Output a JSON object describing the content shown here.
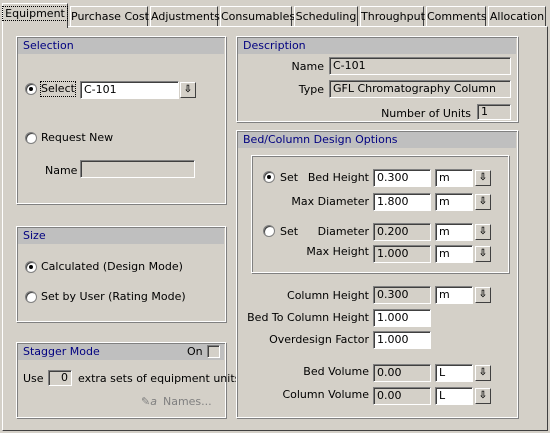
{
  "tabs": [
    "Equipment",
    "Purchase Cost",
    "Adjustments",
    "Consumables",
    "Scheduling",
    "Throughput",
    "Comments",
    "Allocation"
  ],
  "active_tab": "Equipment",
  "selection": {
    "header": "Selection",
    "select_label": "Select",
    "select_value": "C-101",
    "request_new_label": "Request New",
    "name_label": "Name",
    "name_value": ""
  },
  "size": {
    "header": "Size",
    "calculated_label": "Calculated (Design Mode)",
    "rating_label": "Set by User (Rating Mode)"
  },
  "stagger": {
    "header": "Stagger Mode",
    "on_label": "On",
    "use_label": "Use",
    "use_value": "0",
    "extra_label": "extra sets of equipment units",
    "names_button": "Names..."
  },
  "description": {
    "header": "Description",
    "name_label": "Name",
    "name_value": "C-101",
    "type_label": "Type",
    "type_value": "GFL Chromatography Column",
    "units_label": "Number of Units",
    "units_value": "1"
  },
  "bed": {
    "header": "Bed/Column Design Options",
    "set_label_1": "Set",
    "set_label_2": "Set",
    "bed_height_label": "Bed Height",
    "bed_height_value": "0.300",
    "bed_height_unit": "m",
    "max_diameter_label": "Max Diameter",
    "max_diameter_value": "1.800",
    "max_diameter_unit": "m",
    "diameter_label": "Diameter",
    "diameter_value": "0.200",
    "diameter_unit": "m",
    "max_height_label": "Max Height",
    "max_height_value": "1.000",
    "max_height_unit": "m",
    "column_height_label": "Column Height",
    "column_height_value": "0.300",
    "column_height_unit": "m",
    "bed_to_column_label": "Bed To Column Height",
    "bed_to_column_value": "1.000",
    "overdesign_label": "Overdesign Factor",
    "overdesign_value": "1.000",
    "bed_volume_label": "Bed Volume",
    "bed_volume_value": "0.00",
    "bed_volume_unit": "L",
    "column_volume_label": "Column Volume",
    "column_volume_value": "0.00",
    "column_volume_unit": "L"
  },
  "icons": {
    "dropdown": "down-arrow-icon",
    "names": "pencil-a-icon"
  }
}
